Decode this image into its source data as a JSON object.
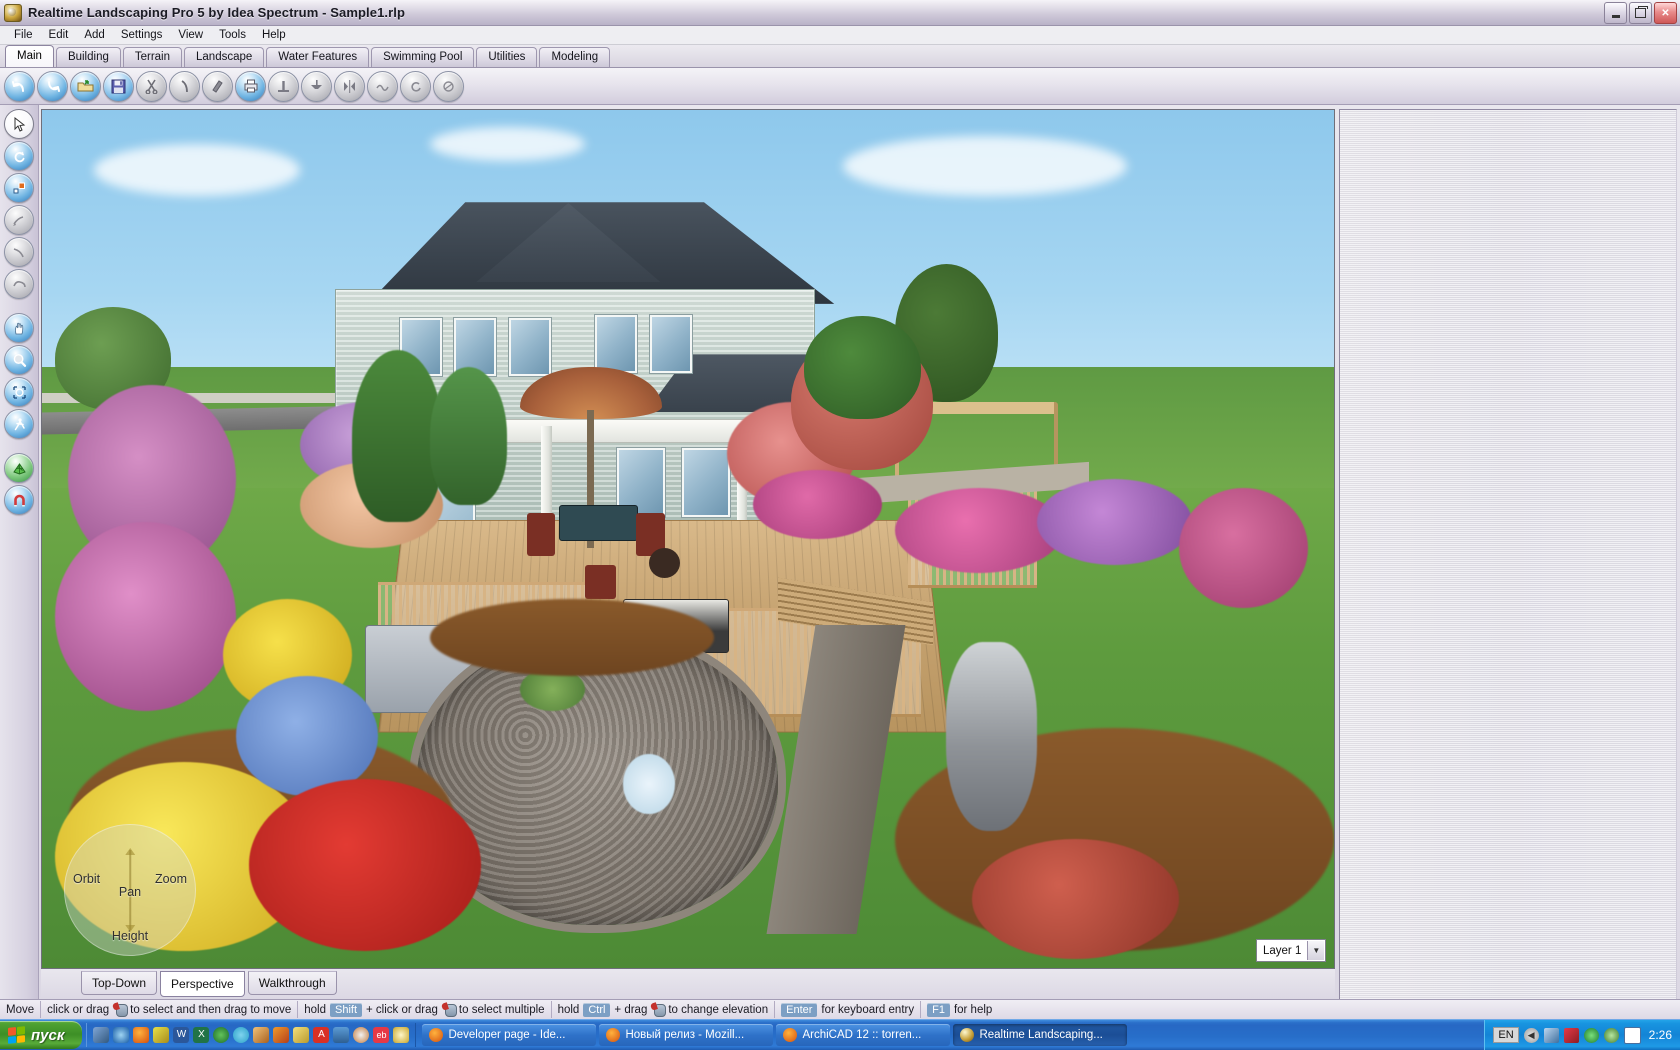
{
  "window": {
    "title": "Realtime Landscaping Pro 5 by Idea Spectrum - Sample1.rlp",
    "app_icon": "app-logo-icon",
    "controls": {
      "minimize": "minimize-icon",
      "restore": "restore-icon",
      "close": "close-icon"
    }
  },
  "menu": {
    "items": [
      "File",
      "Edit",
      "Add",
      "Settings",
      "View",
      "Tools",
      "Help"
    ]
  },
  "tabs": {
    "active": "Main",
    "items": [
      "Main",
      "Building",
      "Terrain",
      "Landscape",
      "Water Features",
      "Swimming Pool",
      "Utilities",
      "Modeling"
    ]
  },
  "toolbar": {
    "buttons": [
      {
        "name": "undo-icon",
        "state": "enabled"
      },
      {
        "name": "redo-icon",
        "state": "enabled"
      },
      {
        "name": "open-folder-icon",
        "state": "enabled"
      },
      {
        "name": "save-icon",
        "state": "enabled"
      },
      {
        "name": "cut-icon",
        "state": "disabled"
      },
      {
        "name": "copy-icon",
        "state": "disabled"
      },
      {
        "name": "paste-icon",
        "state": "disabled"
      },
      {
        "name": "print-icon",
        "state": "enabled"
      },
      {
        "name": "align-icon",
        "state": "disabled"
      },
      {
        "name": "distribute-icon",
        "state": "disabled"
      },
      {
        "name": "mirror-icon",
        "state": "disabled"
      },
      {
        "name": "smooth-icon",
        "state": "disabled"
      },
      {
        "name": "rotate-icon",
        "state": "disabled"
      },
      {
        "name": "scale-icon",
        "state": "disabled"
      }
    ]
  },
  "tool_rail": {
    "buttons": [
      {
        "name": "select-arrow-icon",
        "state": "selected"
      },
      {
        "name": "rotate-object-icon",
        "state": "enabled"
      },
      {
        "name": "resize-object-icon",
        "state": "enabled"
      },
      {
        "name": "paint-icon",
        "state": "disabled"
      },
      {
        "name": "curve-icon",
        "state": "disabled"
      },
      {
        "name": "region-icon",
        "state": "disabled"
      },
      {
        "name": "pan-hand-icon",
        "state": "enabled"
      },
      {
        "name": "zoom-icon",
        "state": "enabled"
      },
      {
        "name": "orbit-icon",
        "state": "enabled"
      },
      {
        "name": "walk-icon",
        "state": "enabled"
      },
      {
        "name": "grid-icon",
        "state": "enabled"
      },
      {
        "name": "magnet-icon",
        "state": "enabled"
      }
    ]
  },
  "viewport": {
    "navigation_wheel": {
      "orbit": "Orbit",
      "zoom": "Zoom",
      "pan": "Pan",
      "height": "Height"
    },
    "layer_selector": {
      "value": "Layer 1",
      "chevron": "chevron-down-icon"
    }
  },
  "view_tabs": {
    "active": "Perspective",
    "items": [
      "Top-Down",
      "Perspective",
      "Walkthrough"
    ]
  },
  "status_bar": {
    "mode": "Move",
    "hints": [
      {
        "pre": "click or drag",
        "mouse": "mouse-icon",
        "post": "to select and then drag to move"
      },
      {
        "pre": "hold",
        "key": "Shift",
        "mid": "+ click or drag",
        "mouse": "mouse-icon",
        "post": "to select multiple"
      },
      {
        "pre": "hold",
        "key": "Ctrl",
        "mid": "+ drag",
        "mouse": "mouse-icon",
        "post": "to change elevation"
      },
      {
        "key": "Enter",
        "post": "for keyboard entry"
      },
      {
        "key": "F1",
        "post": "for help"
      }
    ]
  },
  "taskbar": {
    "start_label": "пуск",
    "quick_launch": [
      "show-desktop-icon",
      "internet-explorer-icon",
      "firefox-icon",
      "media-icon",
      "word-icon",
      "excel-icon",
      "player-icon",
      "utility-icon",
      "photo-icon",
      "autocad-icon",
      "notes-icon",
      "acrobat-icon",
      "usb-icon",
      "paint-icon",
      "ebay-icon",
      "clock-widget-icon"
    ],
    "windows": [
      {
        "label": "Developer page - Ide...",
        "icon": "firefox-icon",
        "active": false
      },
      {
        "label": "Новый релиз - Mozill...",
        "icon": "firefox-icon",
        "active": false
      },
      {
        "label": "ArchiCAD 12 :: torren...",
        "icon": "firefox-icon",
        "active": false
      },
      {
        "label": "Realtime Landscaping...",
        "icon": "app-logo-icon",
        "active": true
      }
    ],
    "tray": {
      "language": "EN",
      "icons": [
        "chevron-left-icon",
        "network-icon",
        "nod32-icon",
        "power-icon",
        "green-shield-icon",
        "mail-icon"
      ],
      "clock": "2:26"
    }
  },
  "colors": {
    "title_gradient_start": "#f5f3f8",
    "tab_active": "#ffffff",
    "taskbar_blue": "#2768c4",
    "start_green": "#3d8f26",
    "key_badge": "#7c9fc4",
    "sky": "#a6d6f2",
    "lawn": "#5e9b3e"
  }
}
